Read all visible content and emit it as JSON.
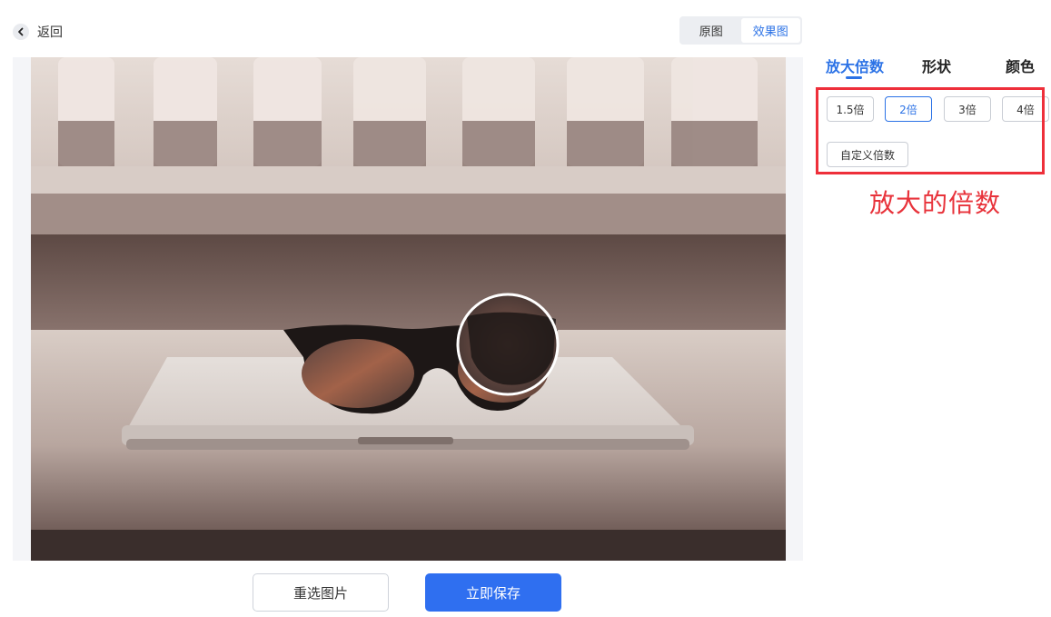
{
  "header": {
    "back_label": "返回",
    "view_toggle": {
      "original_label": "原图",
      "effect_label": "效果图",
      "active": "效果图"
    }
  },
  "actions": {
    "reselect_label": "重选图片",
    "save_label": "立即保存"
  },
  "panel": {
    "tabs": [
      {
        "label": "放大倍数",
        "active": true
      },
      {
        "label": "形状",
        "active": false
      },
      {
        "label": "颜色",
        "active": false
      }
    ],
    "magnification_options": [
      {
        "label": "1.5倍",
        "selected": false
      },
      {
        "label": "2倍",
        "selected": true
      },
      {
        "label": "3倍",
        "selected": false
      },
      {
        "label": "4倍",
        "selected": false
      }
    ],
    "custom_label": "自定义倍数"
  },
  "annotation": {
    "text": "放大的倍数",
    "color": "#e8333b"
  },
  "colors": {
    "accent": "#2b72e6",
    "primary_button": "#2f6ff0",
    "highlight_border": "#ee2f3a"
  }
}
